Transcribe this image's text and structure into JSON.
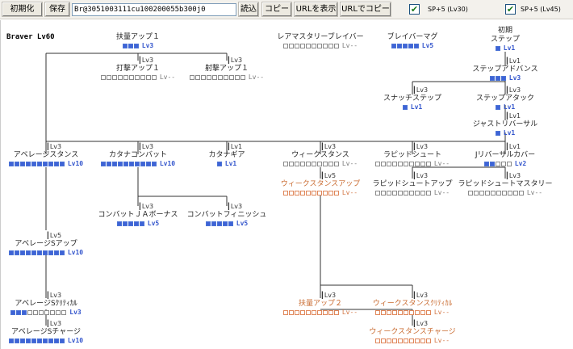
{
  "toolbar": {
    "reset_label": "初期化",
    "save_label": "保存",
    "build_code": "Br@3051003111cu100200055b300j0",
    "load_label": "読込",
    "copy_label": "コピー",
    "show_url_label": "URLを表示",
    "copy_url_label": "URLでコピー",
    "sp_lv30": {
      "checked": true,
      "label": "SP+5 (Lv30)"
    },
    "sp_lv45": {
      "checked": true,
      "label": "SP+5 (Lv45)"
    }
  },
  "tree": {
    "class_title": "Braver Lv60",
    "skills": [
      {
        "id": "buff-up-1",
        "name": "扶量アップ１",
        "filled": 3,
        "total": 3,
        "level": "Lv3",
        "style": "blue",
        "req": ""
      },
      {
        "id": "strike-up-1",
        "name": "打撃アップ１",
        "filled": 0,
        "total": 10,
        "level": "Lv--",
        "style": "grey",
        "req": "Lv3"
      },
      {
        "id": "shot-up-1",
        "name": "射撃アップ１",
        "filled": 0,
        "total": 10,
        "level": "Lv--",
        "style": "grey",
        "req": "Lv3"
      },
      {
        "id": "rare-mastery",
        "name": "レアマスタリーブレイバー",
        "filled": 0,
        "total": 10,
        "level": "Lv--",
        "style": "grey",
        "req": ""
      },
      {
        "id": "brave-mag",
        "name": "ブレイバーマグ",
        "filled": 5,
        "total": 5,
        "level": "Lv5",
        "style": "blue",
        "req": ""
      },
      {
        "id": "initial-step",
        "name": "初期\nステップ",
        "filled": 1,
        "total": 1,
        "level": "Lv1",
        "style": "blue",
        "req": ""
      },
      {
        "id": "step-advance",
        "name": "ステップアドバンス",
        "filled": 3,
        "total": 3,
        "level": "Lv3",
        "style": "blue",
        "req": "Lv1"
      },
      {
        "id": "snatch-step",
        "name": "スナッチステップ",
        "filled": 1,
        "total": 1,
        "level": "Lv1",
        "style": "blue",
        "req": "Lv3"
      },
      {
        "id": "step-attack",
        "name": "ステップアタック",
        "filled": 1,
        "total": 1,
        "level": "Lv1",
        "style": "blue",
        "req": "Lv3"
      },
      {
        "id": "just-reversal",
        "name": "ジャストリバーサル",
        "filled": 1,
        "total": 1,
        "level": "Lv1",
        "style": "blue",
        "req": "Lv1"
      },
      {
        "id": "average-stance",
        "name": "アベレージスタンス",
        "filled": 10,
        "total": 10,
        "level": "Lv10",
        "style": "blue",
        "req": "Lv3"
      },
      {
        "id": "katana-combat",
        "name": "カタナコンバット",
        "filled": 10,
        "total": 10,
        "level": "Lv10",
        "style": "blue",
        "req": "Lv3"
      },
      {
        "id": "katana-gear",
        "name": "カタナギア",
        "filled": 1,
        "total": 1,
        "level": "Lv1",
        "style": "blue",
        "req": "Lv1"
      },
      {
        "id": "weak-stance",
        "name": "ウィークスタンス",
        "filled": 0,
        "total": 10,
        "level": "Lv--",
        "style": "grey",
        "req": "Lv3"
      },
      {
        "id": "rapid-shoot",
        "name": "ラピッドシュート",
        "filled": 0,
        "total": 10,
        "level": "Lv--",
        "style": "grey",
        "req": "Lv3"
      },
      {
        "id": "j-reversal-cover",
        "name": "Jリバーサルカバー",
        "filled": 2,
        "total": 5,
        "level": "Lv2",
        "style": "blue",
        "req": "Lv1"
      },
      {
        "id": "weak-stance-up",
        "name": "ウィークスタンスアップ",
        "filled": 0,
        "total": 10,
        "level": "Lv--",
        "style": "orange",
        "req": "Lv5"
      },
      {
        "id": "rapid-shoot-up",
        "name": "ラピッドシュートアップ",
        "filled": 0,
        "total": 10,
        "level": "Lv--",
        "style": "grey",
        "req": "Lv3"
      },
      {
        "id": "rapid-shoot-mastery",
        "name": "ラピッドシュートマスタリー",
        "filled": 0,
        "total": 10,
        "level": "Lv--",
        "style": "grey",
        "req": "Lv3"
      },
      {
        "id": "combat-ja-bonus",
        "name": "コンバットＪＡボーナス",
        "filled": 5,
        "total": 5,
        "level": "Lv5",
        "style": "blue",
        "req": "Lv3"
      },
      {
        "id": "combat-finish",
        "name": "コンバットフィニッシュ",
        "filled": 5,
        "total": 5,
        "level": "Lv5",
        "style": "blue",
        "req": "Lv3"
      },
      {
        "id": "average-s-up",
        "name": "アベレージSアップ",
        "filled": 10,
        "total": 10,
        "level": "Lv10",
        "style": "blue",
        "req": "Lv5"
      },
      {
        "id": "average-s-critical",
        "name": "アベレージSｸﾘﾃｨｶﾙ",
        "filled": 3,
        "total": 10,
        "level": "Lv3",
        "style": "blue",
        "req": "Lv3"
      },
      {
        "id": "buff-up-2",
        "name": "扶量アップ２",
        "filled": 0,
        "total": 10,
        "level": "Lv--",
        "style": "orange",
        "req": "Lv3"
      },
      {
        "id": "weak-stance-critical",
        "name": "ウィークスタンスｸﾘﾃｨｶﾙ",
        "filled": 0,
        "total": 10,
        "level": "Lv--",
        "style": "orange",
        "req": "Lv3"
      },
      {
        "id": "average-s-charge",
        "name": "アベレージSチャージ",
        "filled": 10,
        "total": 10,
        "level": "Lv10",
        "style": "blue",
        "req": "Lv3"
      },
      {
        "id": "weak-stance-charge",
        "name": "ウィークスタンスチャージ",
        "filled": 0,
        "total": 10,
        "level": "Lv--",
        "style": "orange",
        "req": "Lv3"
      }
    ]
  }
}
